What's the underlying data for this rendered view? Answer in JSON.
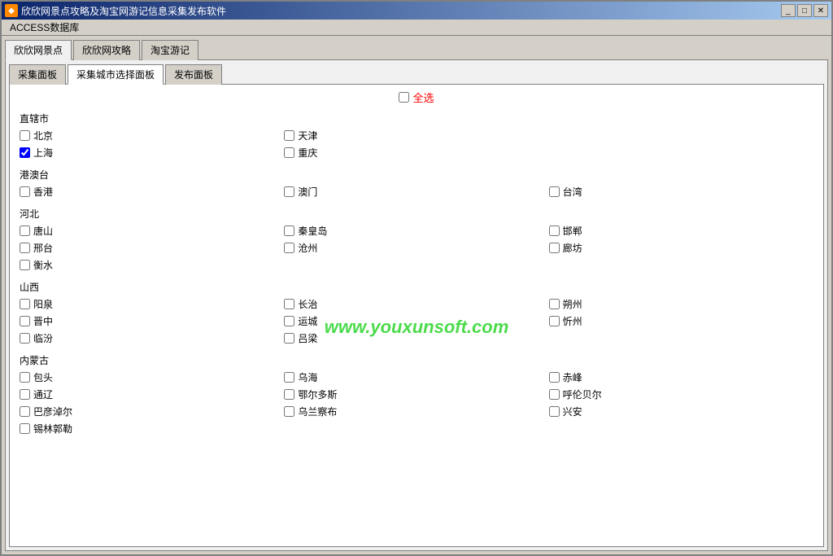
{
  "window": {
    "title": "欣欣网景点攻略及淘宝网游记信息采集发布软件",
    "icon": "◆"
  },
  "titlebar_controls": {
    "minimize": "_",
    "maximize": "□",
    "close": "✕"
  },
  "menu": {
    "items": [
      "ACCESS数据库"
    ]
  },
  "tabs1": {
    "items": [
      "欣欣网景点",
      "欣欣网攻略",
      "淘宝游记"
    ]
  },
  "tabs2": {
    "items": [
      "采集面板",
      "采集城市选择面板",
      "发布面板"
    ]
  },
  "select_all": {
    "label": "全选"
  },
  "watermark": "www.youxunsoft.com",
  "regions": [
    {
      "title": "直辖市",
      "cities": [
        "北京",
        "天津",
        "上海",
        "重庆"
      ]
    },
    {
      "title": "港澳台",
      "cities": [
        "香港",
        "澳门",
        "台湾"
      ]
    },
    {
      "title": "河北",
      "cities": [
        "唐山",
        "秦皇岛",
        "邯郸",
        "邢台",
        "沧州",
        "廊坊",
        "衡水"
      ]
    },
    {
      "title": "山西",
      "cities": [
        "阳泉",
        "长治",
        "朔州",
        "晋中",
        "运城",
        "忻州",
        "临汾",
        "吕梁"
      ]
    },
    {
      "title": "内蒙古",
      "cities": [
        "包头",
        "乌海",
        "赤峰",
        "通辽",
        "鄂尔多斯",
        "呼伦贝尔",
        "巴彦淖尔",
        "乌兰察布",
        "兴安",
        "锡林郭勒"
      ]
    }
  ]
}
